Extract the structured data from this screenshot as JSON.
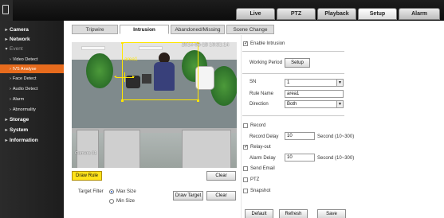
{
  "top_nav": {
    "tabs": [
      {
        "label": "Live",
        "active": false
      },
      {
        "label": "PTZ",
        "active": false
      },
      {
        "label": "Playback",
        "active": false
      },
      {
        "label": "Setup",
        "active": true
      },
      {
        "label": "Alarm",
        "active": false
      }
    ]
  },
  "sidebar": {
    "items": [
      {
        "label": "Camera",
        "level": "top"
      },
      {
        "label": "Network",
        "level": "top"
      },
      {
        "label": "Event",
        "level": "top-open"
      },
      {
        "label": "Video Detect",
        "level": "sub"
      },
      {
        "label": "IVS Analyse",
        "level": "sub",
        "active": true
      },
      {
        "label": "Face Detect",
        "level": "sub"
      },
      {
        "label": "Audio Detect",
        "level": "sub"
      },
      {
        "label": "Alarm",
        "level": "sub"
      },
      {
        "label": "Abnormality",
        "level": "sub"
      },
      {
        "label": "Storage",
        "level": "top"
      },
      {
        "label": "System",
        "level": "top"
      },
      {
        "label": "Information",
        "level": "top"
      }
    ]
  },
  "sub_tabs": [
    {
      "label": "Tripwire",
      "active": false
    },
    {
      "label": "Intrusion",
      "active": true
    },
    {
      "label": "Abandoned/Missing",
      "active": false
    },
    {
      "label": "Scene Change",
      "active": false
    }
  ],
  "video": {
    "timestamp": "2014-06-18 10:31:14",
    "rule_label": "area1",
    "channel_name": "Camera 01"
  },
  "video_controls": {
    "draw_rule": "Draw Rule",
    "clear": "Clear"
  },
  "target_filter": {
    "label": "Target Filter",
    "max_size": "Max Size",
    "min_size": "Min Size",
    "selected": "Max Size",
    "draw_target": "Draw Target",
    "clear": "Clear"
  },
  "settings": {
    "enable_intrusion": {
      "label": "Enable Intrusion",
      "checked": true
    },
    "working_period": {
      "label": "Working Period",
      "button": "Setup"
    },
    "sn": {
      "label": "SN",
      "value": "1"
    },
    "rule_name": {
      "label": "Rule Name",
      "value": "area1"
    },
    "direction": {
      "label": "Direction",
      "value": "Both"
    },
    "record": {
      "label": "Record",
      "checked": false
    },
    "record_delay": {
      "label": "Record Delay",
      "value": "10",
      "unit": "Second (10~300)"
    },
    "relay_out": {
      "label": "Relay-out",
      "checked": true
    },
    "alarm_delay": {
      "label": "Alarm Delay",
      "value": "10",
      "unit": "Second (10~300)"
    },
    "send_email": {
      "label": "Send Email",
      "checked": false
    },
    "ptz": {
      "label": "PTZ",
      "checked": false
    },
    "snapshot": {
      "label": "Snapshot",
      "checked": false
    }
  },
  "footer_buttons": {
    "default": "Default",
    "refresh": "Refresh",
    "save": "Save"
  },
  "colors": {
    "active_sidebar": "#e76b1d",
    "rule_outline": "#ffe600",
    "draw_rule_button": "#ffe21a"
  }
}
